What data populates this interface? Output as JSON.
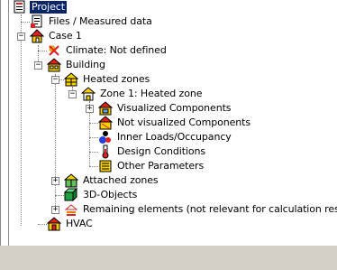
{
  "tree": {
    "project": "Project",
    "files": "Files / Measured data",
    "case1": "Case 1",
    "climate": "Climate: Not defined",
    "building": "Building",
    "heated_zones": "Heated zones",
    "zone1": "Zone 1: Heated zone",
    "visualized": "Visualized Components",
    "not_visualized": "Not visualized Components",
    "inner_loads": "Inner Loads/Occupancy",
    "design_conditions": "Design Conditions",
    "other_parameters": "Other Parameters",
    "attached_zones": "Attached zones",
    "objects3d": "3D-Objects",
    "remaining": "Remaining elements (not relevant for calculation results)",
    "hvac": "HVAC"
  },
  "expanders": {
    "minus": "−",
    "plus": "+"
  },
  "icons": [
    "project-icon",
    "document-icon",
    "house-icon",
    "climate-icon",
    "building-icon",
    "heated-zone-icon",
    "zone-icon",
    "visualized-icon",
    "not-visualized-icon",
    "inner-loads-icon",
    "design-conditions-icon",
    "other-parameters-icon",
    "attached-zones-icon",
    "3d-objects-icon",
    "remaining-elements-icon",
    "hvac-icon"
  ],
  "colors": {
    "selection": "#0a246a",
    "tree_lines": "#808080",
    "house_yellow": "#f8d000",
    "roof_red": "#e02020"
  }
}
